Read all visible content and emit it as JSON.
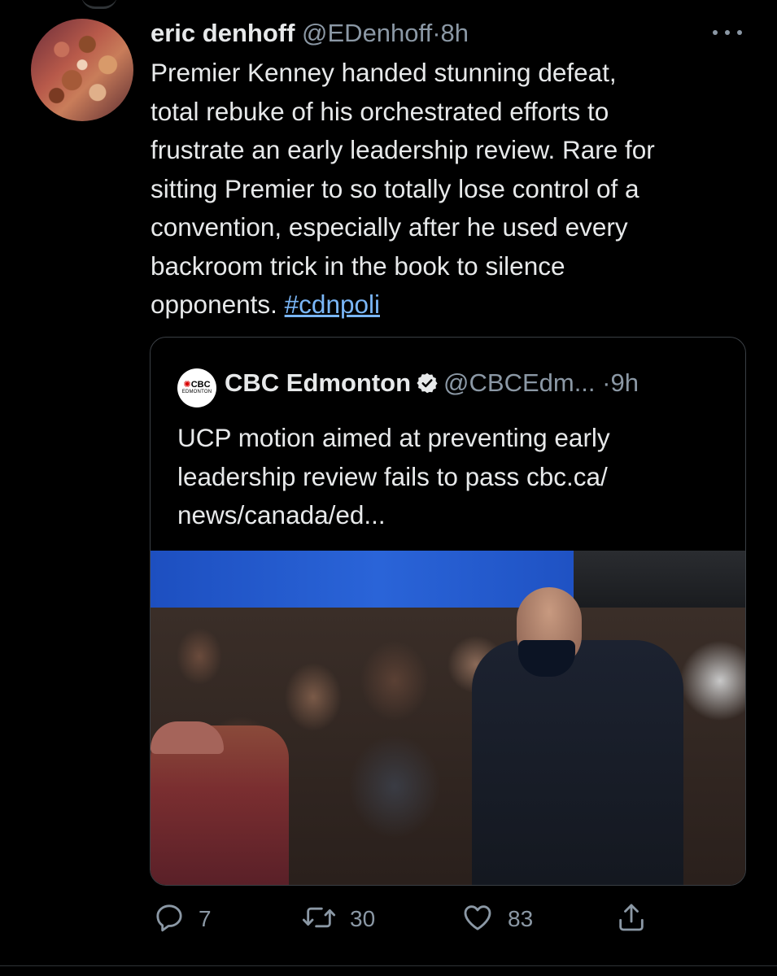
{
  "tweet": {
    "author_name": "eric denhoff",
    "handle": "@EDenhoff",
    "separator": "·",
    "time": "8h",
    "text_lines": [
      "Premier Kenney handed stunning defeat,",
      "total rebuke of his orchestrated efforts to",
      "frustrate an early leadership review. Rare for",
      "sitting Premier to so totally lose control of a",
      "convention, especially after he used every",
      "backroom trick in the book to silence",
      "opponents."
    ],
    "hashtag": "#cdnpoli"
  },
  "quoted_tweet": {
    "logo_text": "CBC",
    "logo_subtext": "EDMONTON",
    "author_name": "CBC Edmonton",
    "handle": "@CBCEdm...",
    "separator": "·",
    "time": "9h",
    "text_lines": [
      "UCP motion aimed at preventing early",
      "leadership review fails to pass cbc.ca/",
      "news/canada/ed..."
    ]
  },
  "actions": {
    "replies": "7",
    "retweets": "30",
    "likes": "83"
  },
  "colors": {
    "background": "#000000",
    "text": "#e7e9ea",
    "secondary": "#8b98a5",
    "link": "#7ab6f7",
    "border": "#3a3f44"
  }
}
